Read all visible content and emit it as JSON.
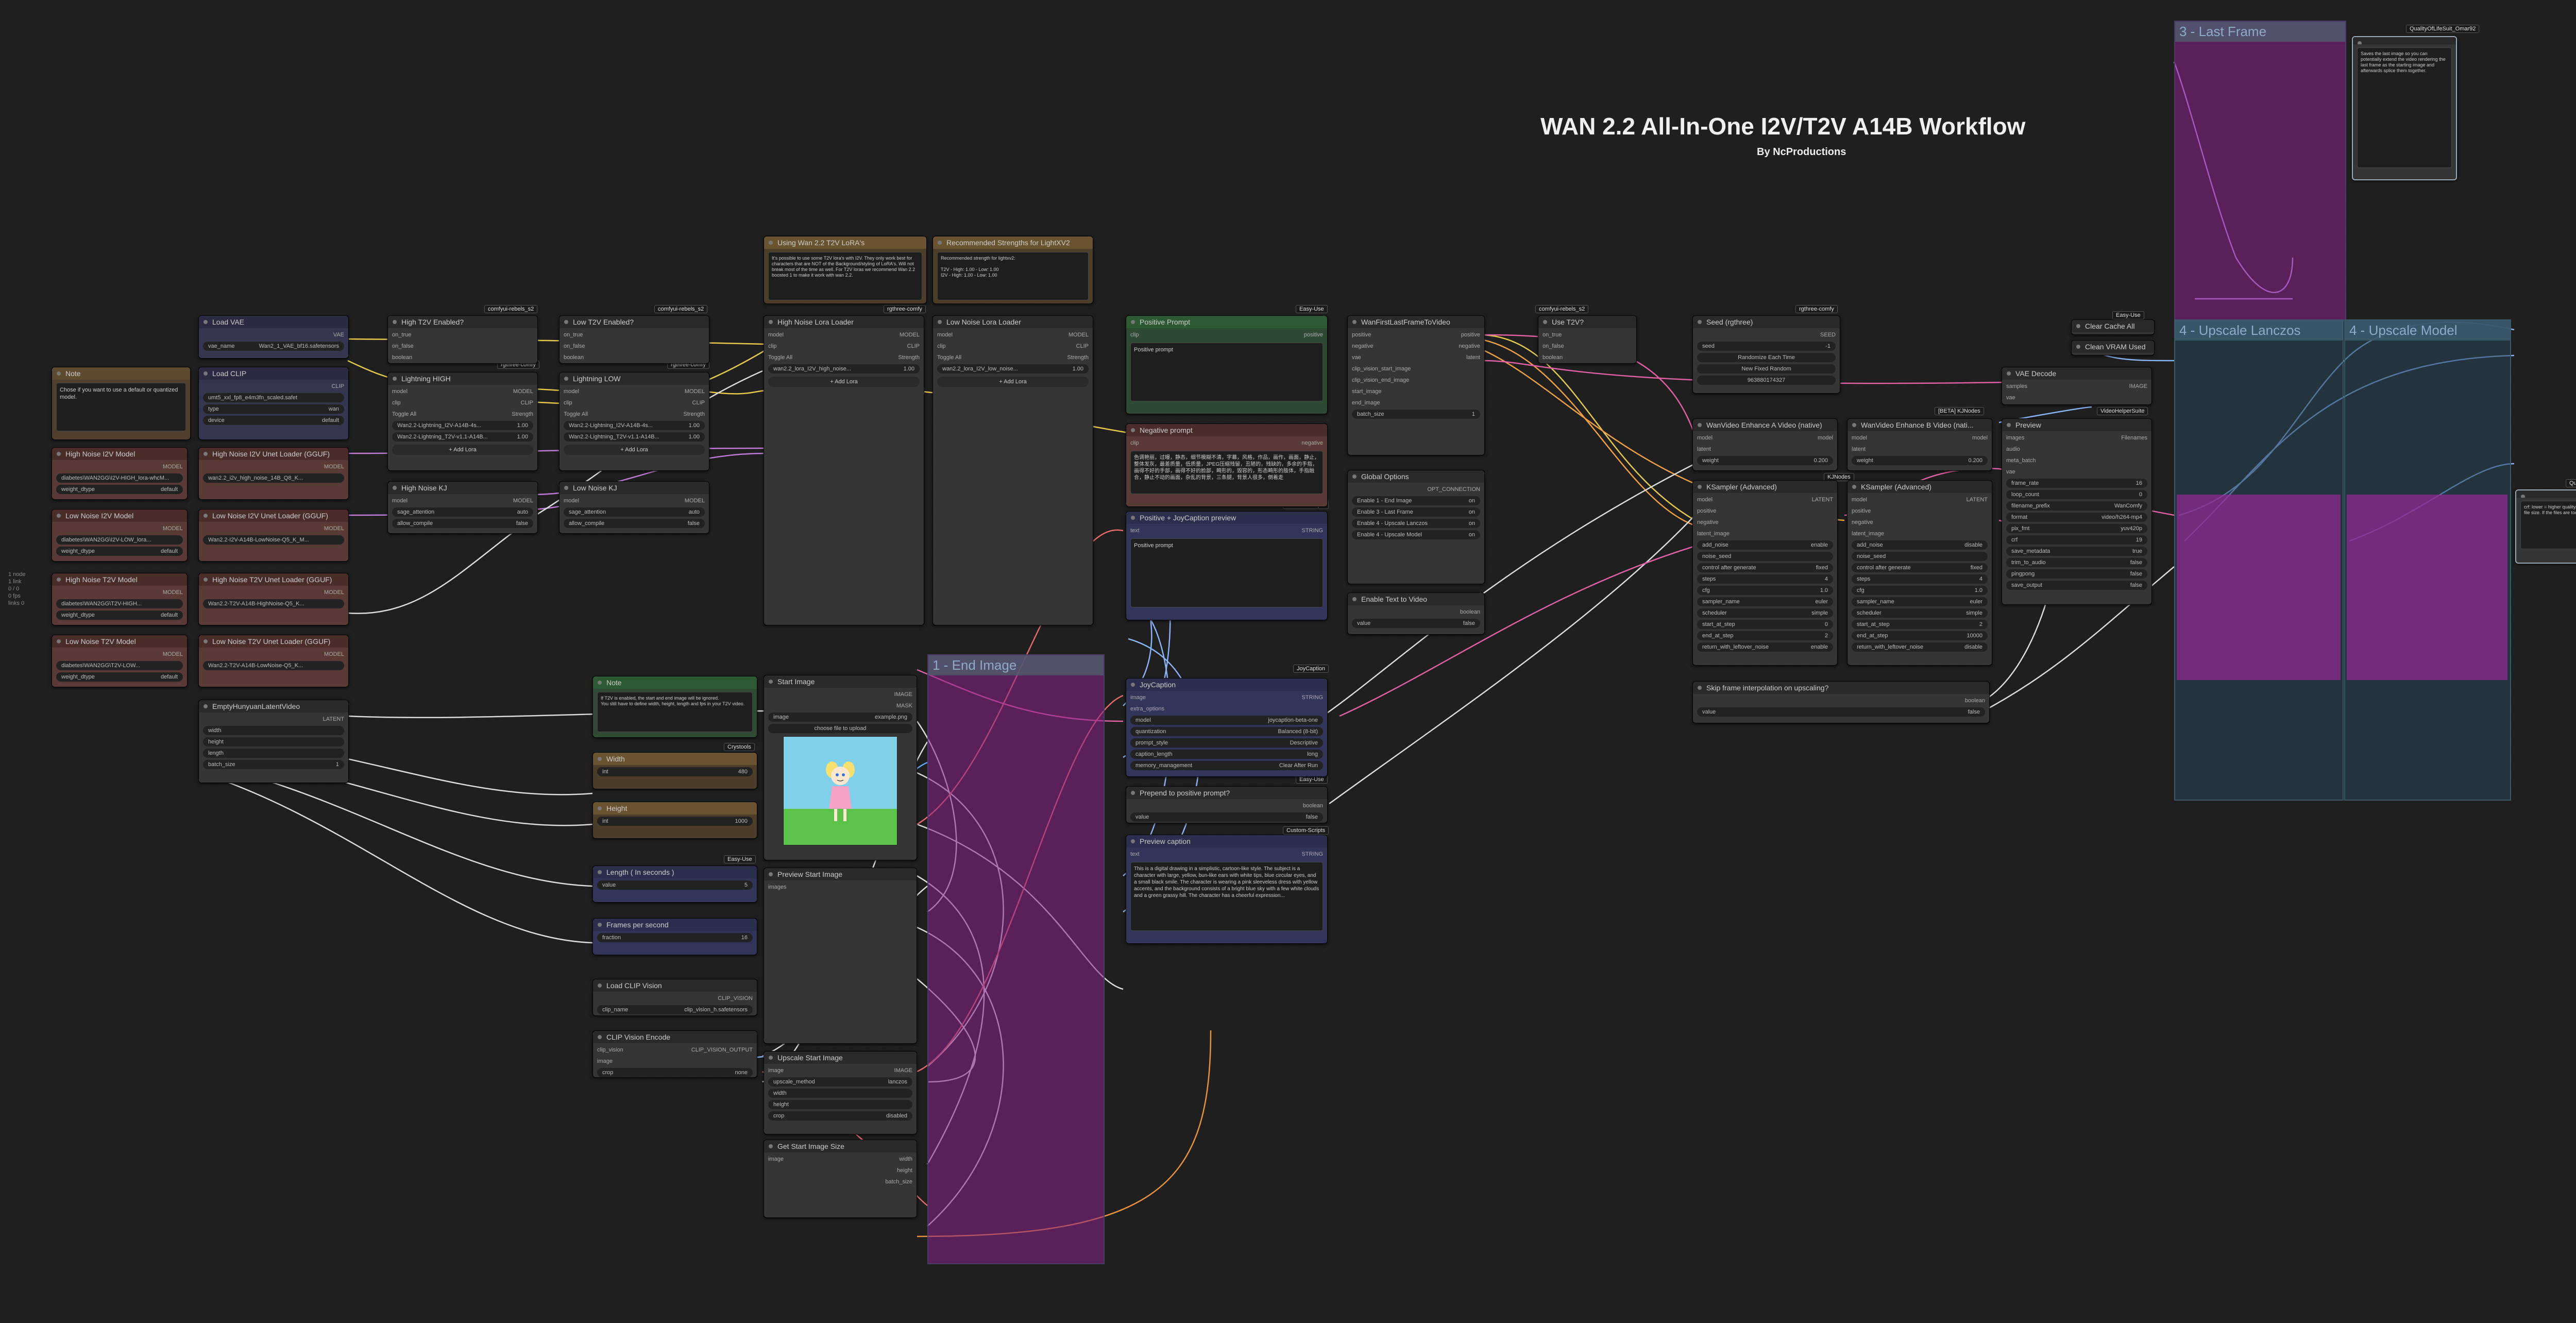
{
  "title": "WAN 2.2 All-In-One I2V/T2V A14B Workflow",
  "subtitle": "By NcProductions",
  "side_note": "1 node\n1 link\n0 / 0\n0 fps\nlinks 0",
  "groups": {
    "end_image": "1 - End Image",
    "last_frame": "3 - Last Frame",
    "upscale_lanczos": "4 - Upscale Lanczos",
    "upscale_model": "4 - Upscale Model"
  },
  "badges": {
    "comfyui_nodes_a": "comfyui-rebels_s2",
    "comfyui_nodes_b": "comfyui-rebels_s2",
    "rgthree_a": "rgthree-comfy",
    "rgthree_b": "rgthree-comfy",
    "rgthree_c": "rgthree-comfy",
    "rgthree_d": "rgthree-comfy",
    "easy_use_a": "Easy-Use",
    "easy_use_b": "Easy-Use",
    "easy_use_c": "Easy-Use",
    "easy_use_d": "Easy-Use",
    "custom_scripts_a": "Custom-Scripts",
    "custom_scripts_b": "Custom-Scripts",
    "joycaption": "JoyCaption",
    "kjnodes_a": "KJNodes",
    "kjnodes_b": "[BETA] KJNodes",
    "crystools": "Crystools",
    "videohelper": "VideoHelperSuite",
    "quality_a": "QualityOfLifeSuit_Omar92",
    "quality_b": "QualityOfLifeSuit_Omar92"
  },
  "nodes": {
    "load_vae": {
      "title": "Load VAE",
      "vae_name": "Wan2_1_VAE_bf16.safetensors"
    },
    "load_clip": {
      "title": "Load CLIP",
      "clip_name": "umt5_xxl_fp8_e4m3fn_scaled.safet",
      "type": "wan",
      "device": "default"
    },
    "note_left": {
      "title": "Note",
      "text": "Chose if you want to use a default or quantized model."
    },
    "high_noise_i2v": {
      "title": "High Noise I2V Model",
      "model": "diabetes\\WAN2GG\\I2V-HIGH_lora-whcM...",
      "dtype": "default"
    },
    "high_noise_i2v_gguf": {
      "title": "High Noise I2V Unet Loader (GGUF)",
      "unet": "wan2.2_i2v_high_noise_14B_Q8_K..."
    },
    "low_noise_i2v": {
      "title": "Low Noise I2V Model",
      "model": "diabetes\\WAN2GG\\I2V-LOW_lora...",
      "dtype": "default"
    },
    "low_noise_i2v_gguf": {
      "title": "Low Noise I2V Unet Loader (GGUF)",
      "unet": "Wan2.2-I2V-A14B-LowNoise-Q5_K_M..."
    },
    "high_noise_t2v": {
      "title": "High Noise T2V Model",
      "model": "diabetes\\WAN2GG\\T2V-HIGH...",
      "dtype": "default"
    },
    "high_noise_t2v_gguf": {
      "title": "High Noise T2V Unet Loader (GGUF)",
      "unet": "Wan2.2-T2V-A14B-HighNoise-Q5_K..."
    },
    "low_noise_t2v": {
      "title": "Low Noise T2V Model",
      "model": "diabetes\\WAN2GG\\T2V-LOW...",
      "dtype": "default"
    },
    "low_noise_t2v_gguf": {
      "title": "Low Noise T2V Unet Loader (GGUF)",
      "unet": "Wan2.2-T2V-A14B-LowNoise-Q5_K..."
    },
    "empty_latent": {
      "title": "EmptyHunyuanLatentVideo",
      "out": "LATENT",
      "width": "width",
      "height": "height",
      "length": "length",
      "batch_size": "batch_size",
      "batch_value": "1"
    },
    "high_t2v_enabled": {
      "title": "High T2V Enabled?",
      "a": "on_true",
      "b": "on_false",
      "c": "boolean"
    },
    "low_t2v_enabled": {
      "title": "Low T2V Enabled?",
      "a": "on_true",
      "b": "on_false",
      "c": "boolean"
    },
    "lightning_high": {
      "title": "Lightning HIGH",
      "toggle": "Toggle All",
      "strength": "Strength",
      "lora1": "Wan2.2-Lightning_I2V-A14B-4s...",
      "lora2": "Wan2.2-Lightning_T2V-v1.1-A14B...",
      "s1": "1.00",
      "s2": "1.00",
      "add": "+ Add Lora"
    },
    "lightning_low": {
      "title": "Lightning LOW",
      "toggle": "Toggle All",
      "strength": "Strength",
      "lora1": "Wan2.2-Lightning_I2V-A14B-4s...",
      "lora2": "Wan2.2-Lightning_T2V-v1.1-A14B...",
      "s1": "1.00",
      "s2": "1.00",
      "add": "+ Add Lora"
    },
    "high_noise_kj": {
      "title": "High Noise KJ",
      "model": "model",
      "usage": "sage_attention",
      "usage_val": "auto",
      "allow": "allow_compile",
      "allow_val": "false"
    },
    "low_noise_kj": {
      "title": "Low Noise KJ",
      "model": "model",
      "usage": "sage_attention",
      "usage_val": "auto",
      "allow": "allow_compile",
      "allow_val": "false"
    },
    "using_note": {
      "title": "Using Wan 2.2 T2V LoRA's",
      "text": "It's possible to use some T2V lora's with I2V. They only work best for characters that are NOT of the Background/styling of LoRA's. Will not break most of the time as well. For T2V loras we recommend Wan 2.2 boosted 1 to make it work with wan 2.2."
    },
    "recommended_note": {
      "title": "Recommended Strengths for LightXV2",
      "text": "Recommended strength for lightxv2:\n\nT2V - High: 1.00 - Low: 1.00\nI2V - High: 1.00 - Low: 1.00"
    },
    "high_noise_lora": {
      "title": "High Noise Lora Loader",
      "model": "MODEL",
      "clip": "CLIP",
      "toggle": "Toggle All",
      "strength": "Strength",
      "lora1": "wan2.2_lora_I2V_high_noise...",
      "s1": "1.00",
      "add": "+ Add Lora"
    },
    "low_noise_lora": {
      "title": "Low Noise Lora Loader",
      "model": "MODEL",
      "clip": "CLIP",
      "toggle": "Toggle All",
      "strength": "Strength",
      "lora1": "wan2.2_lora_I2V_low_noise...",
      "s1": "1.00",
      "add": "+ Add Lora"
    },
    "positive_prompt": {
      "title": "Positive Prompt",
      "text": "Positive prompt"
    },
    "negative_prompt": {
      "title": "Negative prompt",
      "text": "色调艳丽，过曝，静态，细节模糊不清，字幕，风格，作品，画作，画面，静止，整体发灰，最差质量，低质量，JPEG压缩残留，丑陋的，残缺的，多余的手指，画得不好的手部，画得不好的脸部，畸形的，毁容的，形态畸形的肢体，手指融合，静止不动的画面，杂乱的背景，三条腿，背景人很多，倒着走"
    },
    "positive_joycaption": {
      "title": "Positive + JoyCaption preview",
      "text": "Positive prompt"
    },
    "wan_first_last": {
      "title": "WanFirstLastFrameToVideo",
      "inputs": [
        "positive",
        "negative",
        "vae",
        "clip_vision_start_image",
        "clip_vision_end_image",
        "start_image",
        "end_image"
      ],
      "batch": "batch_size",
      "batch_val": "1"
    },
    "global_options": {
      "title": "Global Options",
      "opt": "OPT_CONNECTION",
      "e1": "Enable 1 - End Image",
      "e2": "Enable 3 - Last Frame",
      "e3": "Enable 4 - Upscale Lanczos",
      "e4": "Enable 4 - Upscale Model"
    },
    "enable_t2v": {
      "title": "Enable Text to Video",
      "out": "boolean",
      "value": "value",
      "value_val": "false"
    },
    "use_t2v": {
      "title": "Use T2V?",
      "a": "on_true",
      "b": "on_false",
      "c": "boolean"
    },
    "seed": {
      "title": "Seed (rgthree)",
      "seed": "seed",
      "seed_val": "-1",
      "r1": "Randomize Each Time",
      "r2": "New Fixed Random",
      "r3": "963880174327"
    },
    "enhance_a": {
      "title": "WanVideo Enhance A Video (native)",
      "model": "model",
      "latent": "latent",
      "weight": "weight",
      "weight_val": "0.200"
    },
    "enhance_b": {
      "title": "WanVideo Enhance B Video (nati...",
      "model": "model",
      "latent": "latent",
      "weight": "weight",
      "weight_val": "0.200"
    },
    "ksampler_a": {
      "title": "KSampler (Advanced)",
      "add_noise": "enable",
      "noise_seed": "noise_seed",
      "control": "fixed",
      "steps": "4",
      "cfg": "1.0",
      "sampler": "euler",
      "scheduler": "simple",
      "start": "0",
      "end": "2",
      "leftover": "enable"
    },
    "ksampler_b": {
      "title": "KSampler (Advanced)",
      "add_noise": "disable",
      "noise_seed": "noise_seed",
      "control": "fixed",
      "steps": "4",
      "cfg": "1.0",
      "sampler": "euler",
      "scheduler": "simple",
      "start": "2",
      "end": "10000",
      "leftover": "disable"
    },
    "skip_interp": {
      "title": "Skip frame interpolation on upscaling?",
      "out": "boolean",
      "value": "value",
      "value_val": "false"
    },
    "vae_decode": {
      "title": "VAE Decode",
      "out": "IMAGE",
      "samples": "samples",
      "vae": "vae"
    },
    "clear_cache": {
      "title": "Clear Cache All",
      "vram": "Clean VRAM Used"
    },
    "preview_main": {
      "title": "Preview",
      "rows": [
        [
          "frame_rate",
          "16"
        ],
        [
          "loop_count",
          "0"
        ],
        [
          "filename_prefix",
          "WanComfy"
        ],
        [
          "format",
          "video/h264-mp4"
        ],
        [
          "pix_fmt",
          "yuv420p"
        ],
        [
          "crf",
          "19"
        ],
        [
          "save_metadata",
          "true"
        ],
        [
          "trim_to_audio",
          "false"
        ],
        [
          "pingpong",
          "false"
        ],
        [
          "save_output",
          "false"
        ]
      ]
    },
    "note_start": {
      "title": "Note",
      "text": "If T2V is enabled, the start and end image will be ignored.\nYou still have to define width, height, length and fps in your T2V video."
    },
    "width": {
      "title": "Width",
      "val": "480"
    },
    "height": {
      "title": "Height",
      "val": "1000"
    },
    "length": {
      "title": "Length ( In seconds )",
      "val": "5"
    },
    "fps": {
      "title": "Frames per second",
      "val": "16"
    },
    "load_clip_vision": {
      "title": "Load CLIP Vision",
      "name": "clip_vision_h.safetensors"
    },
    "clip_vision_encode": {
      "title": "CLIP Vision Encode",
      "crop": "none"
    },
    "start_image": {
      "title": "Start Image",
      "image": "example.png",
      "upload": "choose file to upload"
    },
    "preview_start": {
      "title": "Preview Start Image"
    },
    "upscale_start": {
      "title": "Upscale Start Image",
      "method": "lanczos",
      "crop": "disabled"
    },
    "get_image_size": {
      "title": "Get Start Image Size",
      "out1": "width",
      "out2": "height",
      "out3": "batch_size"
    },
    "joycaption": {
      "title": "JoyCaption",
      "model": "joycaption-beta-one",
      "quant": "Balanced (8-bit)",
      "prompt": "Descriptive",
      "length": "long",
      "memory": "Clear After Run"
    },
    "prepend": {
      "title": "Prepend to positive prompt?",
      "out": "boolean",
      "value_val": "false"
    },
    "preview_caption": {
      "title": "Preview caption",
      "text": "This is a digital drawing in a simplistic, cartoon-like style. The subject is a character with large, yellow, bun-like ears with white tips, blue circular eyes, and a small black smile. The character is wearing a pink sleeveless dress with yellow accents, and the background consists of a bright blue sky with a few white clouds and a green grassy hill. The character has a cheerful expression..."
    },
    "note_right": {
      "text": "Saves the last image so you can potentially extend the video rendering the last frame as the starting image and afterwards splice them together."
    },
    "note_right2": {
      "text": "crf: lower = higher quality/less compression, bigger file size. If the files are too big, set crf to example 19."
    }
  }
}
